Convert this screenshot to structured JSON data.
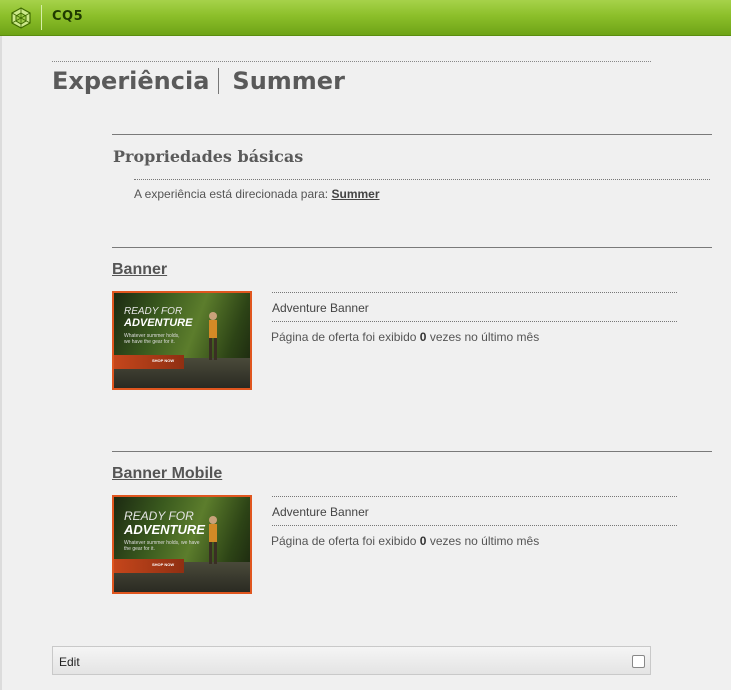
{
  "app": {
    "brand": "CQ5",
    "logo_icon": "cq5-cube-logo-icon",
    "accent_color": "#8cbf2a"
  },
  "page": {
    "title_part1": "Experiência",
    "title_part2": "Summer"
  },
  "basic_properties": {
    "heading": "Propriedades básicas",
    "target_prefix": "A experiência está direcionada para:",
    "target_link": "Summer"
  },
  "offers": [
    {
      "title": "Banner",
      "image_text": {
        "line1": "READY FOR",
        "line2": "ADVENTURE",
        "line3": "Whatever summer holds, we have the gear for it.",
        "button": "SHOP NOW"
      },
      "name": "Adventure Banner",
      "stats_prefix": "Página de oferta foi exibido",
      "views": "0",
      "stats_suffix": "vezes no último mês"
    },
    {
      "title": "Banner Mobile",
      "image_text": {
        "line1": "READY FOR",
        "line2": "ADVENTURE",
        "line3": "Whatever summer holds, we have the gear for it.",
        "button": "SHOP NOW"
      },
      "name": "Adventure Banner",
      "stats_prefix": "Página de oferta foi exibido",
      "views": "0",
      "stats_suffix": "vezes no último mês"
    }
  ],
  "editbar": {
    "label": "Edit"
  }
}
